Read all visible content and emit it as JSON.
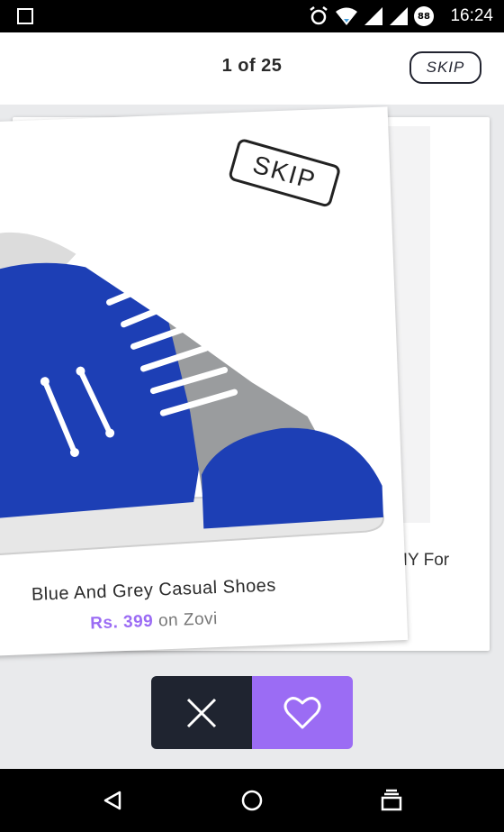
{
  "status_bar": {
    "time": "16:24",
    "battery_level": "88",
    "icons": [
      "notification-square-icon",
      "alarm-icon",
      "wifi-icon",
      "signal-icon",
      "signal-icon",
      "battery-icon"
    ]
  },
  "header": {
    "counter": "1 of 25",
    "skip_label": "SKIP"
  },
  "card_front": {
    "stamp_label": "SKIP",
    "title": "Blue And Grey Casual Shoes",
    "price": "Rs. 399",
    "seller_text": "on Zovi"
  },
  "card_back": {
    "title_fragment": "DIY For"
  },
  "actions": {
    "dislike_icon": "close-icon",
    "like_icon": "heart-icon",
    "colors": {
      "dislike": "#1f2430",
      "like": "#9b6cf4"
    }
  },
  "nav_bar": {
    "icons": [
      "back-icon",
      "home-icon",
      "recents-icon"
    ]
  }
}
